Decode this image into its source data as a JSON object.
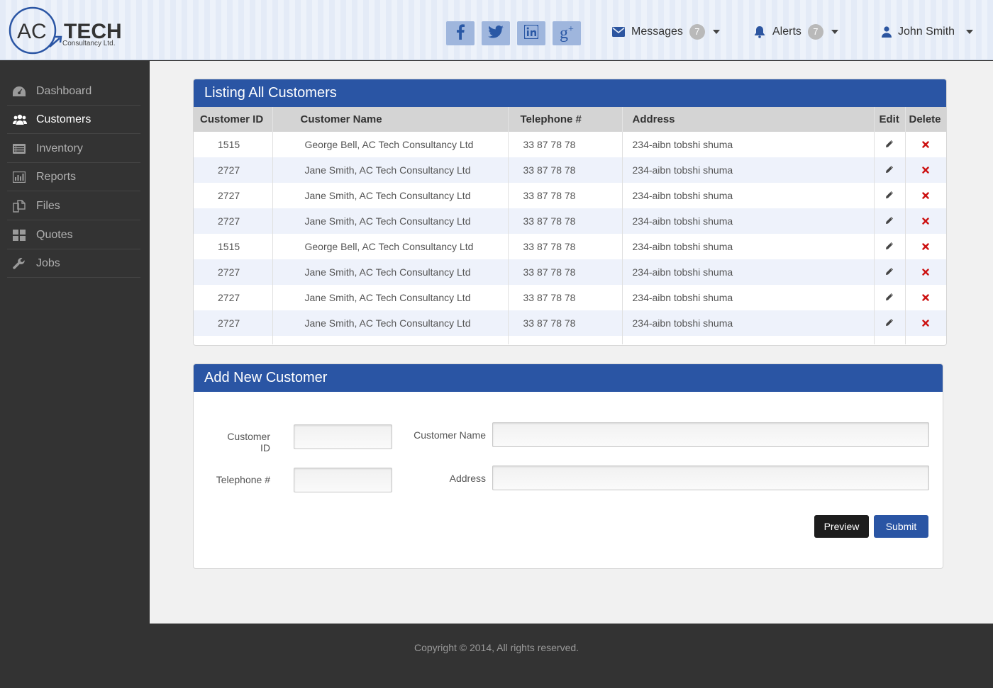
{
  "brand": {
    "logo_main_left": "AC",
    "logo_main_right": "TECH",
    "logo_sub": "Consultancy Ltd."
  },
  "header": {
    "social": [
      "facebook-icon",
      "twitter-icon",
      "linkedin-icon",
      "google-plus-icon"
    ],
    "messages": {
      "label": "Messages",
      "count": "7"
    },
    "alerts": {
      "label": "Alerts",
      "count": "7"
    },
    "user": {
      "name": "John Smith"
    }
  },
  "sidebar": {
    "items": [
      {
        "label": "Dashboard",
        "icon": "dashboard-icon"
      },
      {
        "label": "Customers",
        "icon": "users-icon",
        "active": true
      },
      {
        "label": "Inventory",
        "icon": "list-icon"
      },
      {
        "label": "Reports",
        "icon": "bar-chart-icon"
      },
      {
        "label": "Files",
        "icon": "files-icon"
      },
      {
        "label": "Quotes",
        "icon": "grid-icon"
      },
      {
        "label": "Jobs",
        "icon": "wrench-icon"
      }
    ]
  },
  "listing": {
    "title": "Listing All Customers",
    "columns": [
      "Customer ID",
      "Customer Name",
      "Telephone #",
      "Address",
      "Edit",
      "Delete"
    ],
    "rows": [
      {
        "id": "1515",
        "name": "George Bell, AC Tech Consultancy Ltd",
        "tel": "33 87 78 78",
        "address": "234-aibn tobshi shuma"
      },
      {
        "id": "2727",
        "name": "Jane Smith, AC Tech Consultancy Ltd",
        "tel": "33 87 78 78",
        "address": "234-aibn tobshi shuma"
      },
      {
        "id": "2727",
        "name": "Jane Smith, AC Tech Consultancy Ltd",
        "tel": "33 87 78 78",
        "address": "234-aibn tobshi shuma"
      },
      {
        "id": "2727",
        "name": "Jane Smith, AC Tech Consultancy Ltd",
        "tel": "33 87 78 78",
        "address": "234-aibn tobshi shuma"
      },
      {
        "id": "1515",
        "name": "George Bell, AC Tech Consultancy Ltd",
        "tel": "33 87 78 78",
        "address": "234-aibn tobshi shuma"
      },
      {
        "id": "2727",
        "name": "Jane Smith, AC Tech Consultancy Ltd",
        "tel": "33 87 78 78",
        "address": "234-aibn tobshi shuma"
      },
      {
        "id": "2727",
        "name": "Jane Smith, AC Tech Consultancy Ltd",
        "tel": "33 87 78 78",
        "address": "234-aibn tobshi shuma"
      },
      {
        "id": "2727",
        "name": "Jane Smith, AC Tech Consultancy Ltd",
        "tel": "33 87 78 78",
        "address": "234-aibn tobshi shuma"
      }
    ]
  },
  "form": {
    "title": "Add New Customer",
    "customer_id_label": "Customer ID",
    "customer_id_value": "",
    "customer_name_label": "Customer Name",
    "customer_name_value": "",
    "telephone_label": "Telephone #",
    "telephone_value": "",
    "address_label": "Address",
    "address_value": "",
    "preview_label": "Preview",
    "submit_label": "Submit"
  },
  "footer": {
    "copyright": "Copyright © 2014, All rights reserved."
  },
  "colors": {
    "primary": "#2a55a4",
    "sidebar": "#333333",
    "delete": "#cc1111"
  }
}
